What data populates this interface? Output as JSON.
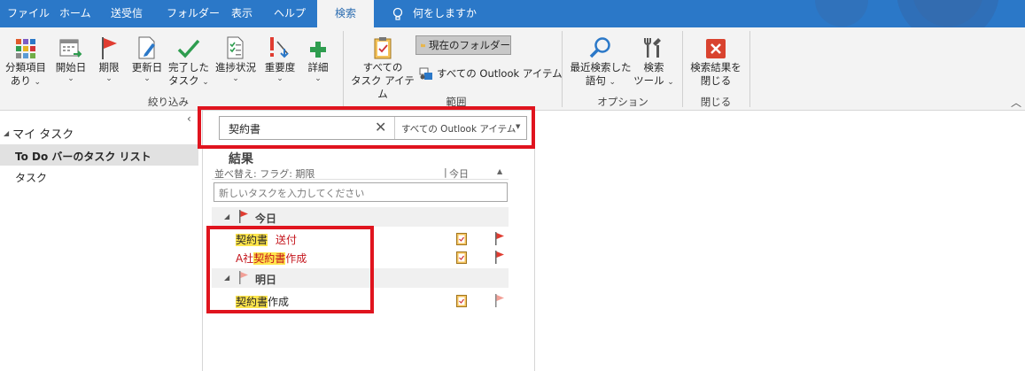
{
  "tabs": [
    {
      "label": "ファイル",
      "active": false
    },
    {
      "label": "ホーム",
      "active": false
    },
    {
      "label": "送受信",
      "active": false
    },
    {
      "label": "フォルダー",
      "active": false
    },
    {
      "label": "表示",
      "active": false
    },
    {
      "label": "ヘルプ",
      "active": false
    },
    {
      "label": "検索",
      "active": true
    }
  ],
  "tell_me": "何をしますか",
  "ribbon": {
    "refine": {
      "label": "絞り込み",
      "buttons": [
        {
          "line1": "分類項目",
          "line2": "あり",
          "dropdown": true,
          "icon": "categorize-icon"
        },
        {
          "line1": "開始日",
          "line2": "",
          "dropdown": true,
          "icon": "start-date-icon"
        },
        {
          "line1": "期限",
          "line2": "",
          "dropdown": true,
          "icon": "flag-icon"
        },
        {
          "line1": "更新日",
          "line2": "",
          "dropdown": true,
          "icon": "modified-icon"
        },
        {
          "line1": "完了した",
          "line2": "タスク",
          "dropdown": true,
          "icon": "check-icon"
        },
        {
          "line1": "進捗状況",
          "line2": "",
          "dropdown": true,
          "icon": "progress-icon"
        },
        {
          "line1": "重要度",
          "line2": "",
          "dropdown": true,
          "icon": "importance-icon"
        },
        {
          "line1": "詳細",
          "line2": "",
          "dropdown": true,
          "icon": "plus-icon"
        }
      ]
    },
    "scope": {
      "label": "範囲",
      "all_tasks_line1": "すべての",
      "all_tasks_line2": "タスク アイテム",
      "current_folder": "現在のフォルダー",
      "all_outlook": "すべての Outlook アイテム"
    },
    "options": {
      "label": "オプション",
      "recent_line1": "最近検索した",
      "recent_line2": "語句",
      "tools_line1": "検索",
      "tools_line2": "ツール"
    },
    "close": {
      "label": "閉じる",
      "line1": "検索結果を",
      "line2": "閉じる"
    }
  },
  "nav": {
    "section": "マイ タスク",
    "items": [
      {
        "label": "To Do バーのタスク リスト",
        "selected": true
      },
      {
        "label": "タスク",
        "selected": false
      }
    ]
  },
  "search": {
    "value": "契約書",
    "scope": "すべての Outlook アイテム"
  },
  "results": {
    "title": "結果",
    "sort_label": "並べ替え: フラグ: 期限",
    "sort_today": "今日",
    "new_task_placeholder": "新しいタスクを入力してください",
    "groups": [
      {
        "label": "今日",
        "tasks": [
          {
            "prefix": "",
            "highlight": "契約書",
            "suffix": "送付",
            "overdue": true
          },
          {
            "prefix": "A社",
            "highlight": "契約書",
            "suffix": "作成",
            "overdue": true
          }
        ]
      },
      {
        "label": "明日",
        "tasks": [
          {
            "prefix": "",
            "highlight": "契約書",
            "suffix": "作成",
            "overdue": false
          }
        ]
      }
    ]
  },
  "colors": {
    "tab_bar": "#2b78c8",
    "ribbon": "#f3f3f3",
    "accent_red": "#e0141e",
    "highlight": "#ffe54c",
    "overdue_text": "#c4151c",
    "flag_today": "#e03c31",
    "flag_tomorrow": "#f2a097"
  }
}
